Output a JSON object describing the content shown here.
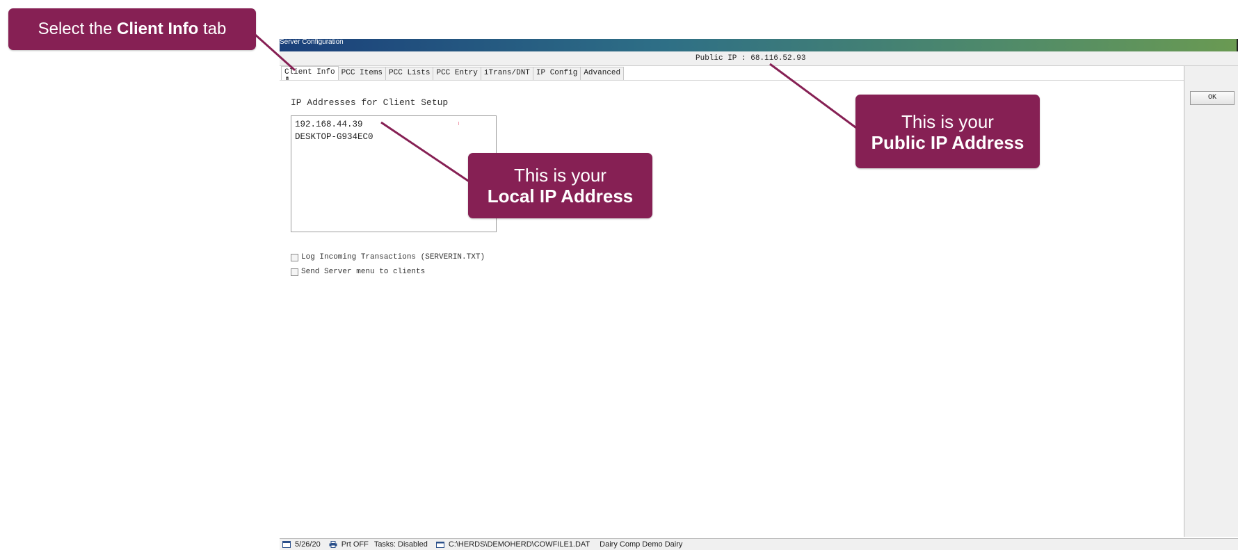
{
  "window": {
    "title": "Server Configuration",
    "public_ip_text": "Public IP : 68.116.52.93"
  },
  "tabs": [
    {
      "label": "Client Info",
      "active": true
    },
    {
      "label": "PCC Items",
      "active": false
    },
    {
      "label": "PCC Lists",
      "active": false
    },
    {
      "label": "PCC Entry",
      "active": false
    },
    {
      "label": "iTrans/DNT",
      "active": false
    },
    {
      "label": "IP Config",
      "active": false
    },
    {
      "label": "Advanced",
      "active": false
    }
  ],
  "buttons": {
    "ok_label": "OK"
  },
  "client_info": {
    "heading": "IP Addresses for Client Setup",
    "ip_entries": [
      "192.168.44.39",
      "DESKTOP-G934EC0"
    ],
    "checkboxes": [
      {
        "label": "Log Incoming Transactions (SERVERIN.TXT)",
        "checked": false
      },
      {
        "label": "Send Server menu to clients",
        "checked": false
      }
    ]
  },
  "status_bar": {
    "date": "5/26/20",
    "printer": "Prt OFF",
    "tasks": "Tasks: Disabled",
    "file_path": "C:\\HERDS\\DEMOHERD\\COWFILE1.DAT",
    "dairy_name": "Dairy Comp Demo Dairy"
  },
  "callouts": {
    "client_info": {
      "prefix": "Select the ",
      "bold": "Client Info",
      "suffix": " tab"
    },
    "local_ip": {
      "line1": "This is your",
      "line2": "Local IP Address"
    },
    "public_ip": {
      "line1": "This is your",
      "line2": "Public IP Address"
    }
  },
  "colors": {
    "callout_bg": "#862054",
    "callout_text": "#ffffff",
    "title_bar_start": "#1a3f7a",
    "title_bar_end": "#6a9a52"
  },
  "icons": {
    "cursor": "hand-pointer-icon",
    "status_date": "calendar-icon",
    "status_printer": "printer-icon",
    "status_file": "folder-icon"
  }
}
